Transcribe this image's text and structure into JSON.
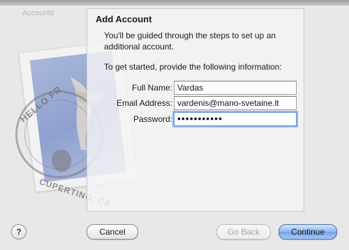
{
  "window": {
    "background_label": "Accounts"
  },
  "stamp": {
    "postmark_top": "HELLO FR",
    "postmark_bottom": "CUPERTINO, CA"
  },
  "sheet": {
    "title": "Add Account",
    "intro": "You'll be guided through the steps to set up an additional account.",
    "prompt": "To get started, provide the following information:",
    "fields": {
      "full_name": {
        "label": "Full Name:",
        "value": "Vardas"
      },
      "email": {
        "label": "Email Address:",
        "value": "vardenis@mano-svetaine.lt"
      },
      "password": {
        "label": "Password:",
        "value": "•••••••••••"
      }
    }
  },
  "buttons": {
    "help": "?",
    "cancel": "Cancel",
    "go_back": "Go Back",
    "continue": "Continue"
  },
  "colors": {
    "accent_blue": "#74a3ea",
    "focus_ring": "#8fb6ef"
  }
}
